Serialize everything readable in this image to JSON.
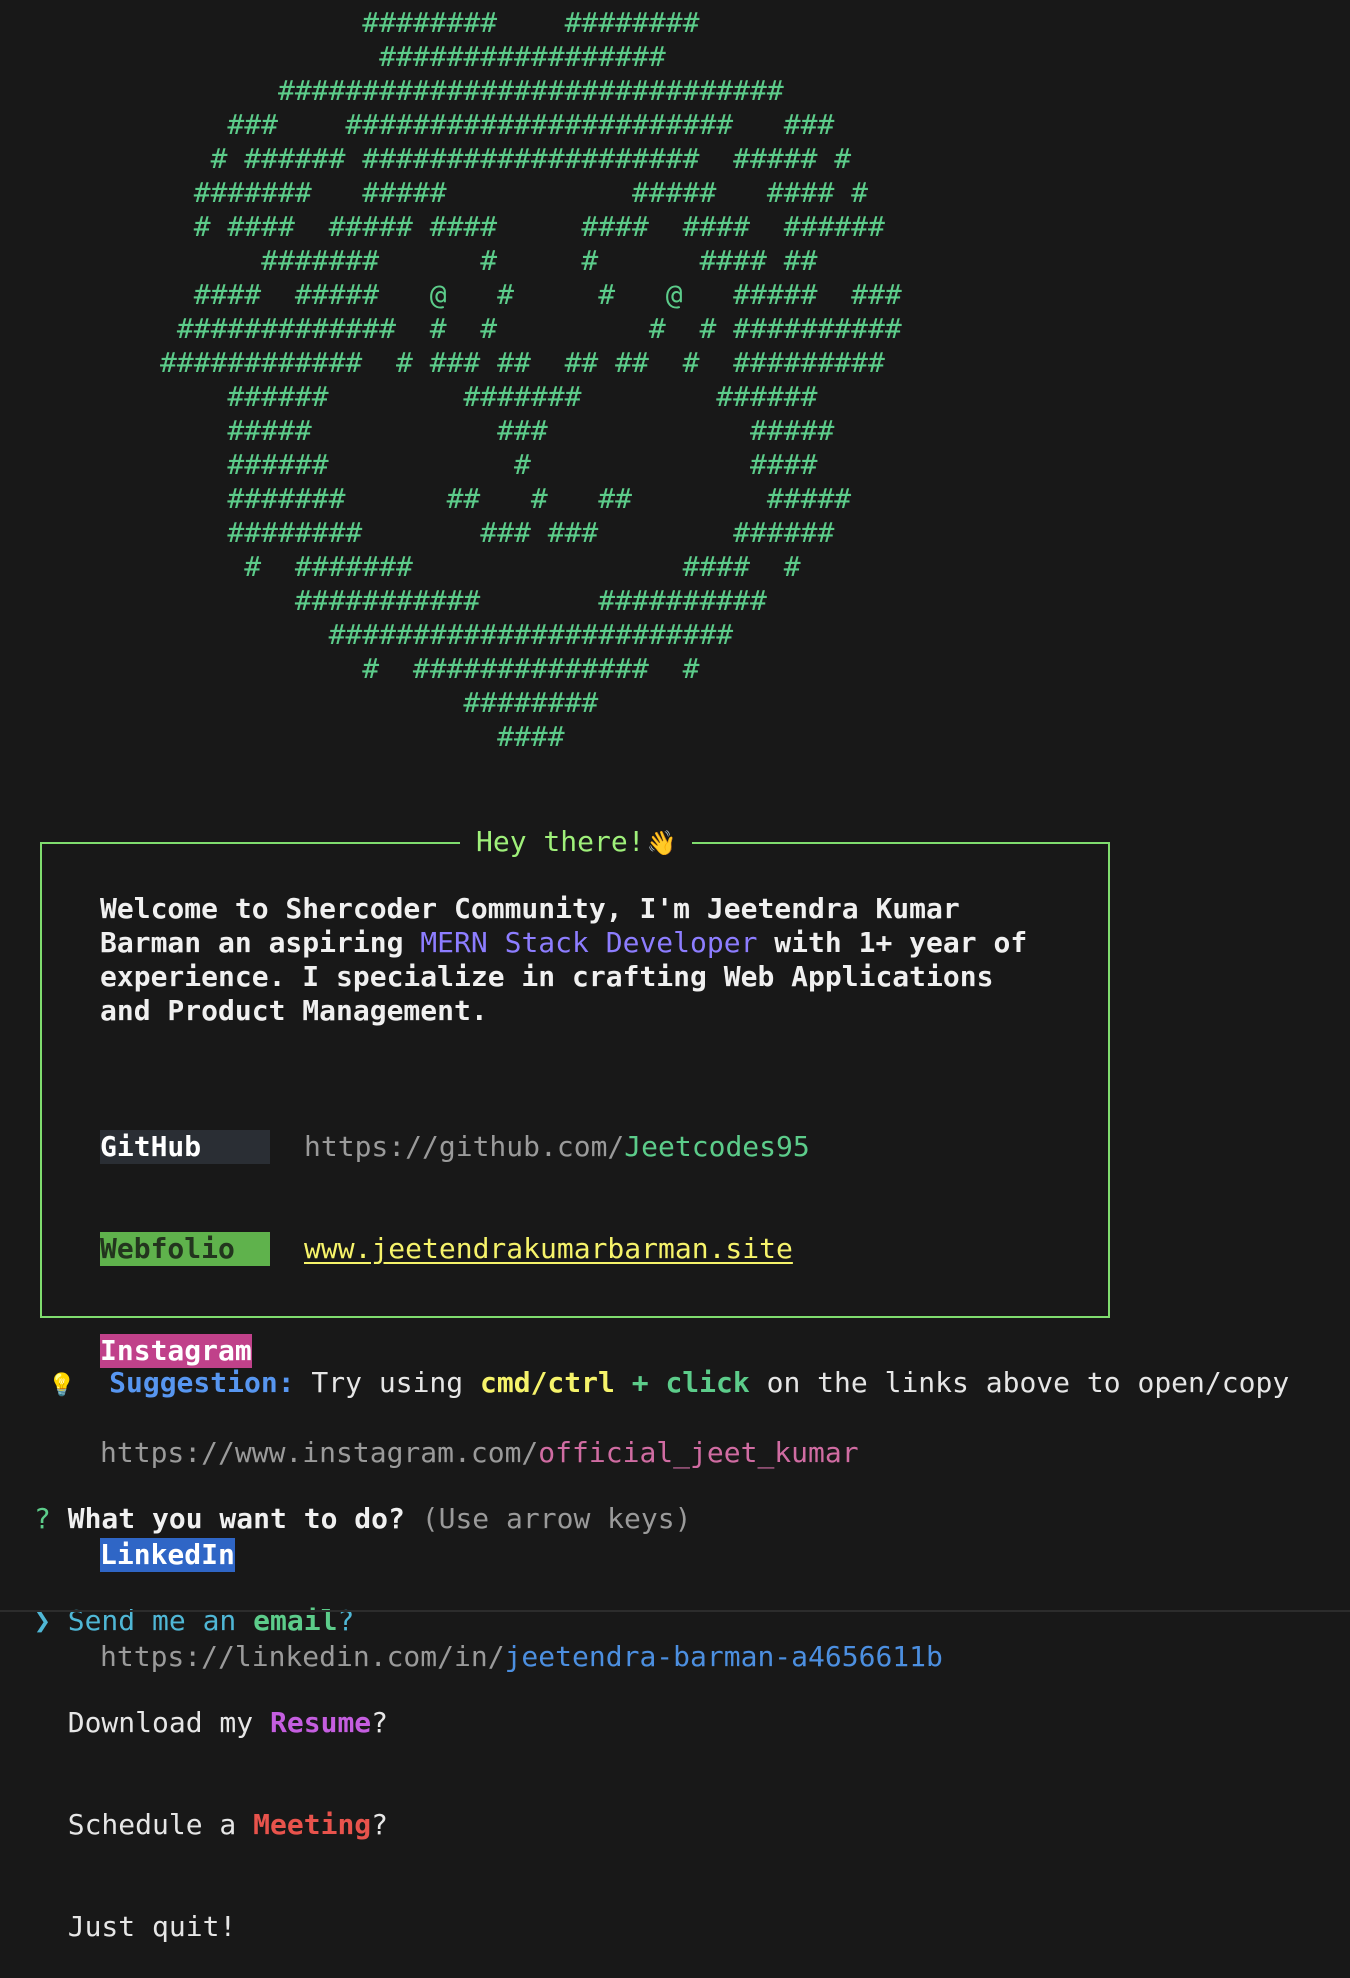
{
  "ascii_art": "            ########    ########\n             #################\n       ##############################\n    ###    #######################   ###\n   # ###### ####################  ##### #\n  #######   #####           #####   #### #\n  # ####  ##### ####     ####  ####  ######\n      #######      #     #      #### ##\n  ####  #####   @   #     #   @   #####  ###\n #############  #  #         #  # ##########\n############  # ### ##  ## ##  #  #########\n    ######        #######        ######\n    #####           ###            #####\n    ######           #             ####\n    #######      ##   #   ##        #####\n    ########       ### ###        ######\n     #  #######                ####  #\n        ###########       ##########\n          ########################\n            #  ##############  #\n                  ########\n                    ####",
  "box": {
    "title": "Hey there!",
    "wave_icon": "👋",
    "welcome_before": "Welcome to Shercoder Community, I'm Jeetendra Kumar Barman an aspiring ",
    "welcome_highlight": "MERN Stack Developer",
    "welcome_after": " with 1+ year of experience. I specialize in crafting Web Applications and Product Management."
  },
  "links": {
    "github": {
      "label": "GitHub",
      "prefix": "https://github.com/",
      "handle": "Jeetcodes95"
    },
    "webfolio": {
      "label": "Webfolio",
      "url": "www.jeetendrakumarbarman.site"
    },
    "instagram": {
      "label": "Instagram",
      "prefix": "https://www.instagram.com/",
      "handle": "official_jeet_kumar"
    },
    "linkedin": {
      "label": "LinkedIn",
      "prefix": "https://linkedin.com/in/",
      "handle": "jeetendra-barman-a4656611b"
    }
  },
  "suggestion": {
    "icon": "💡",
    "label": "Suggestion:",
    "text_1": " Try using ",
    "cmd": "cmd/ctrl",
    "plus": " + ",
    "click": "click",
    "text_2": " on the links above to open/copy"
  },
  "prompt": {
    "question_mark": "?",
    "question": "What you want to do?",
    "hint": "(Use arrow keys)",
    "pointer": "❯",
    "options": [
      {
        "before": "Send me an ",
        "highlight": "email",
        "after": "?"
      },
      {
        "before": "Download my ",
        "highlight": "Resume",
        "after": "?"
      },
      {
        "before": "Schedule a ",
        "highlight": "Meeting",
        "after": "?"
      },
      {
        "before": "Just quit!",
        "highlight": "",
        "after": ""
      }
    ]
  }
}
